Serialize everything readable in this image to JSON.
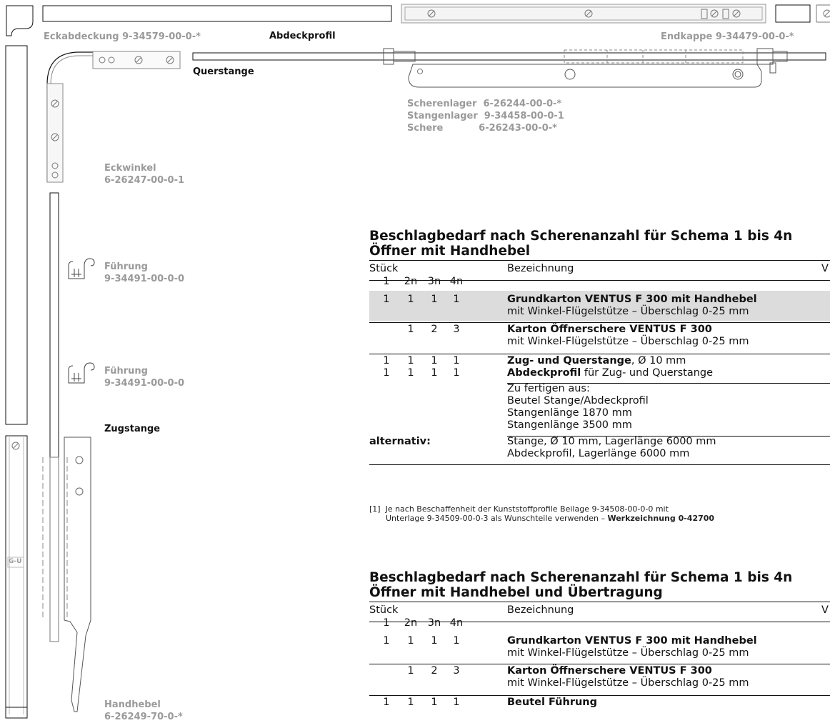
{
  "drawing": {
    "eckabdeckung": "Eckabdeckung 9-34579-00-0-*",
    "abdeckprofil": "Abdeckprofil",
    "endkappe": "Endkappe 9-34479-00-0-*",
    "querstange": "Querstange",
    "scherenlager": "Scherenlager  6-26244-00-0-*",
    "stangenlager": "Stangenlager  9-34458-00-0-1",
    "schere": "Schere           6-26243-00-0-*",
    "eckwinkel_name": "Eckwinkel",
    "eckwinkel_no": "6-26247-00-0-1",
    "fuehrung1_name": "Führung",
    "fuehrung1_no": "9-34491-00-0-0",
    "fuehrung2_name": "Führung",
    "fuehrung2_no": "9-34491-00-0-0",
    "zugstange": "Zugstange",
    "handhebel_name": "Handhebel",
    "handhebel_no": "6-26249-70-0-*",
    "gu_logo": "G-U"
  },
  "table1": {
    "title_line1": "Beschlagbedarf nach Scherenanzahl für Schema 1 bis 4n",
    "title_line2": "Öffner mit Handhebel",
    "header": {
      "stueck": "Stück",
      "cols": [
        "1",
        "2n",
        "3n",
        "4n"
      ],
      "bezeichnung": "Bezeichnung",
      "v": "V"
    },
    "rows": [
      {
        "q": [
          "1",
          "1",
          "1",
          "1"
        ],
        "bold": "Grundkarton VENTUS F 300 mit Handhebel",
        "rest": "",
        "line2": "mit Winkel-Flügelstütze – Überschlag 0-25 mm"
      },
      {
        "q": [
          "",
          "1",
          "2",
          "3"
        ],
        "bold": "Karton Öffnerschere VENTUS F 300",
        "rest": "",
        "line2": "mit Winkel-Flügelstütze – Überschlag 0-25 mm"
      },
      {
        "q": [
          "1",
          "1",
          "1",
          "1"
        ],
        "bold": "Zug- und Querstange",
        "rest": ", Ø 10 mm",
        "line2": ""
      },
      {
        "q": [
          "1",
          "1",
          "1",
          "1"
        ],
        "bold": "Abdeckprofil",
        "rest": " für Zug- und Querstange",
        "line2": ""
      }
    ],
    "fertigen": [
      "Zu fertigen aus:",
      "Beutel Stange/Abdeckprofil",
      "Stangenlänge 1870 mm",
      "Stangenlänge 3500 mm"
    ],
    "alternativ_label": "alternativ:",
    "alternativ": [
      "Stange, Ø 10 mm, Lagerlänge 6000 mm",
      "Abdeckprofil, Lagerlänge 6000 mm"
    ],
    "footnote_line1": "[1]  Je nach Beschaffenheit der Kunststoffprofile Beilage 9-34508-00-0-0 mit",
    "footnote_line2": "Unterlage 9-34509-00-0-3 als Wunschteile verwenden – ",
    "footnote_bold": "Werkzeichnung 0-42700"
  },
  "table2": {
    "title_line1": "Beschlagbedarf nach Scherenanzahl für Schema 1 bis 4n",
    "title_line2": "Öffner mit Handhebel und Übertragung",
    "header": {
      "stueck": "Stück",
      "cols": [
        "1",
        "2n",
        "3n",
        "4n"
      ],
      "bezeichnung": "Bezeichnung",
      "v": "V"
    },
    "rows": [
      {
        "q": [
          "1",
          "1",
          "1",
          "1"
        ],
        "bold": "Grundkarton VENTUS F 300 mit Handhebel",
        "line2": "mit Winkel-Flügelstütze – Überschlag 0-25 mm"
      },
      {
        "q": [
          "",
          "1",
          "2",
          "3"
        ],
        "bold": "Karton Öffnerschere VENTUS F 300",
        "line2": "mit Winkel-Flügelstütze – Überschlag 0-25 mm"
      },
      {
        "q": [
          "1",
          "1",
          "1",
          "1"
        ],
        "bold": "Beutel Führung",
        "line2": ""
      }
    ]
  }
}
